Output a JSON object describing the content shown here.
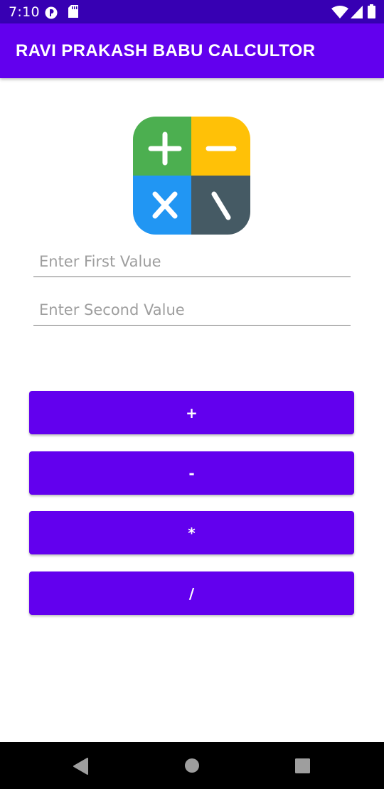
{
  "status_bar": {
    "time": "7:10",
    "left_icons": [
      "data-saver-icon",
      "sd-card-icon"
    ],
    "right_icons": [
      "wifi-icon",
      "cell-signal-icon",
      "battery-icon"
    ]
  },
  "app_bar": {
    "title": "RAVI PRAKASH BABU CALCULTOR"
  },
  "logo": {
    "icons": [
      "plus-icon",
      "minus-icon",
      "multiply-icon",
      "backslash-icon"
    ],
    "colors": {
      "plus": "#4caf50",
      "minus": "#ffc107",
      "multiply": "#2196f3",
      "divide": "#455a64"
    }
  },
  "form": {
    "first_placeholder": "Enter First Value",
    "second_placeholder": "Enter Second Value"
  },
  "buttons": {
    "add": "+",
    "subtract": "-",
    "multiply": "*",
    "divide": "/"
  },
  "nav_bar": {
    "icons": [
      "back-icon",
      "home-icon",
      "recents-icon"
    ]
  },
  "colors": {
    "status_bar": "#3700b3",
    "primary": "#6200ee",
    "nav_bar": "#000000"
  }
}
